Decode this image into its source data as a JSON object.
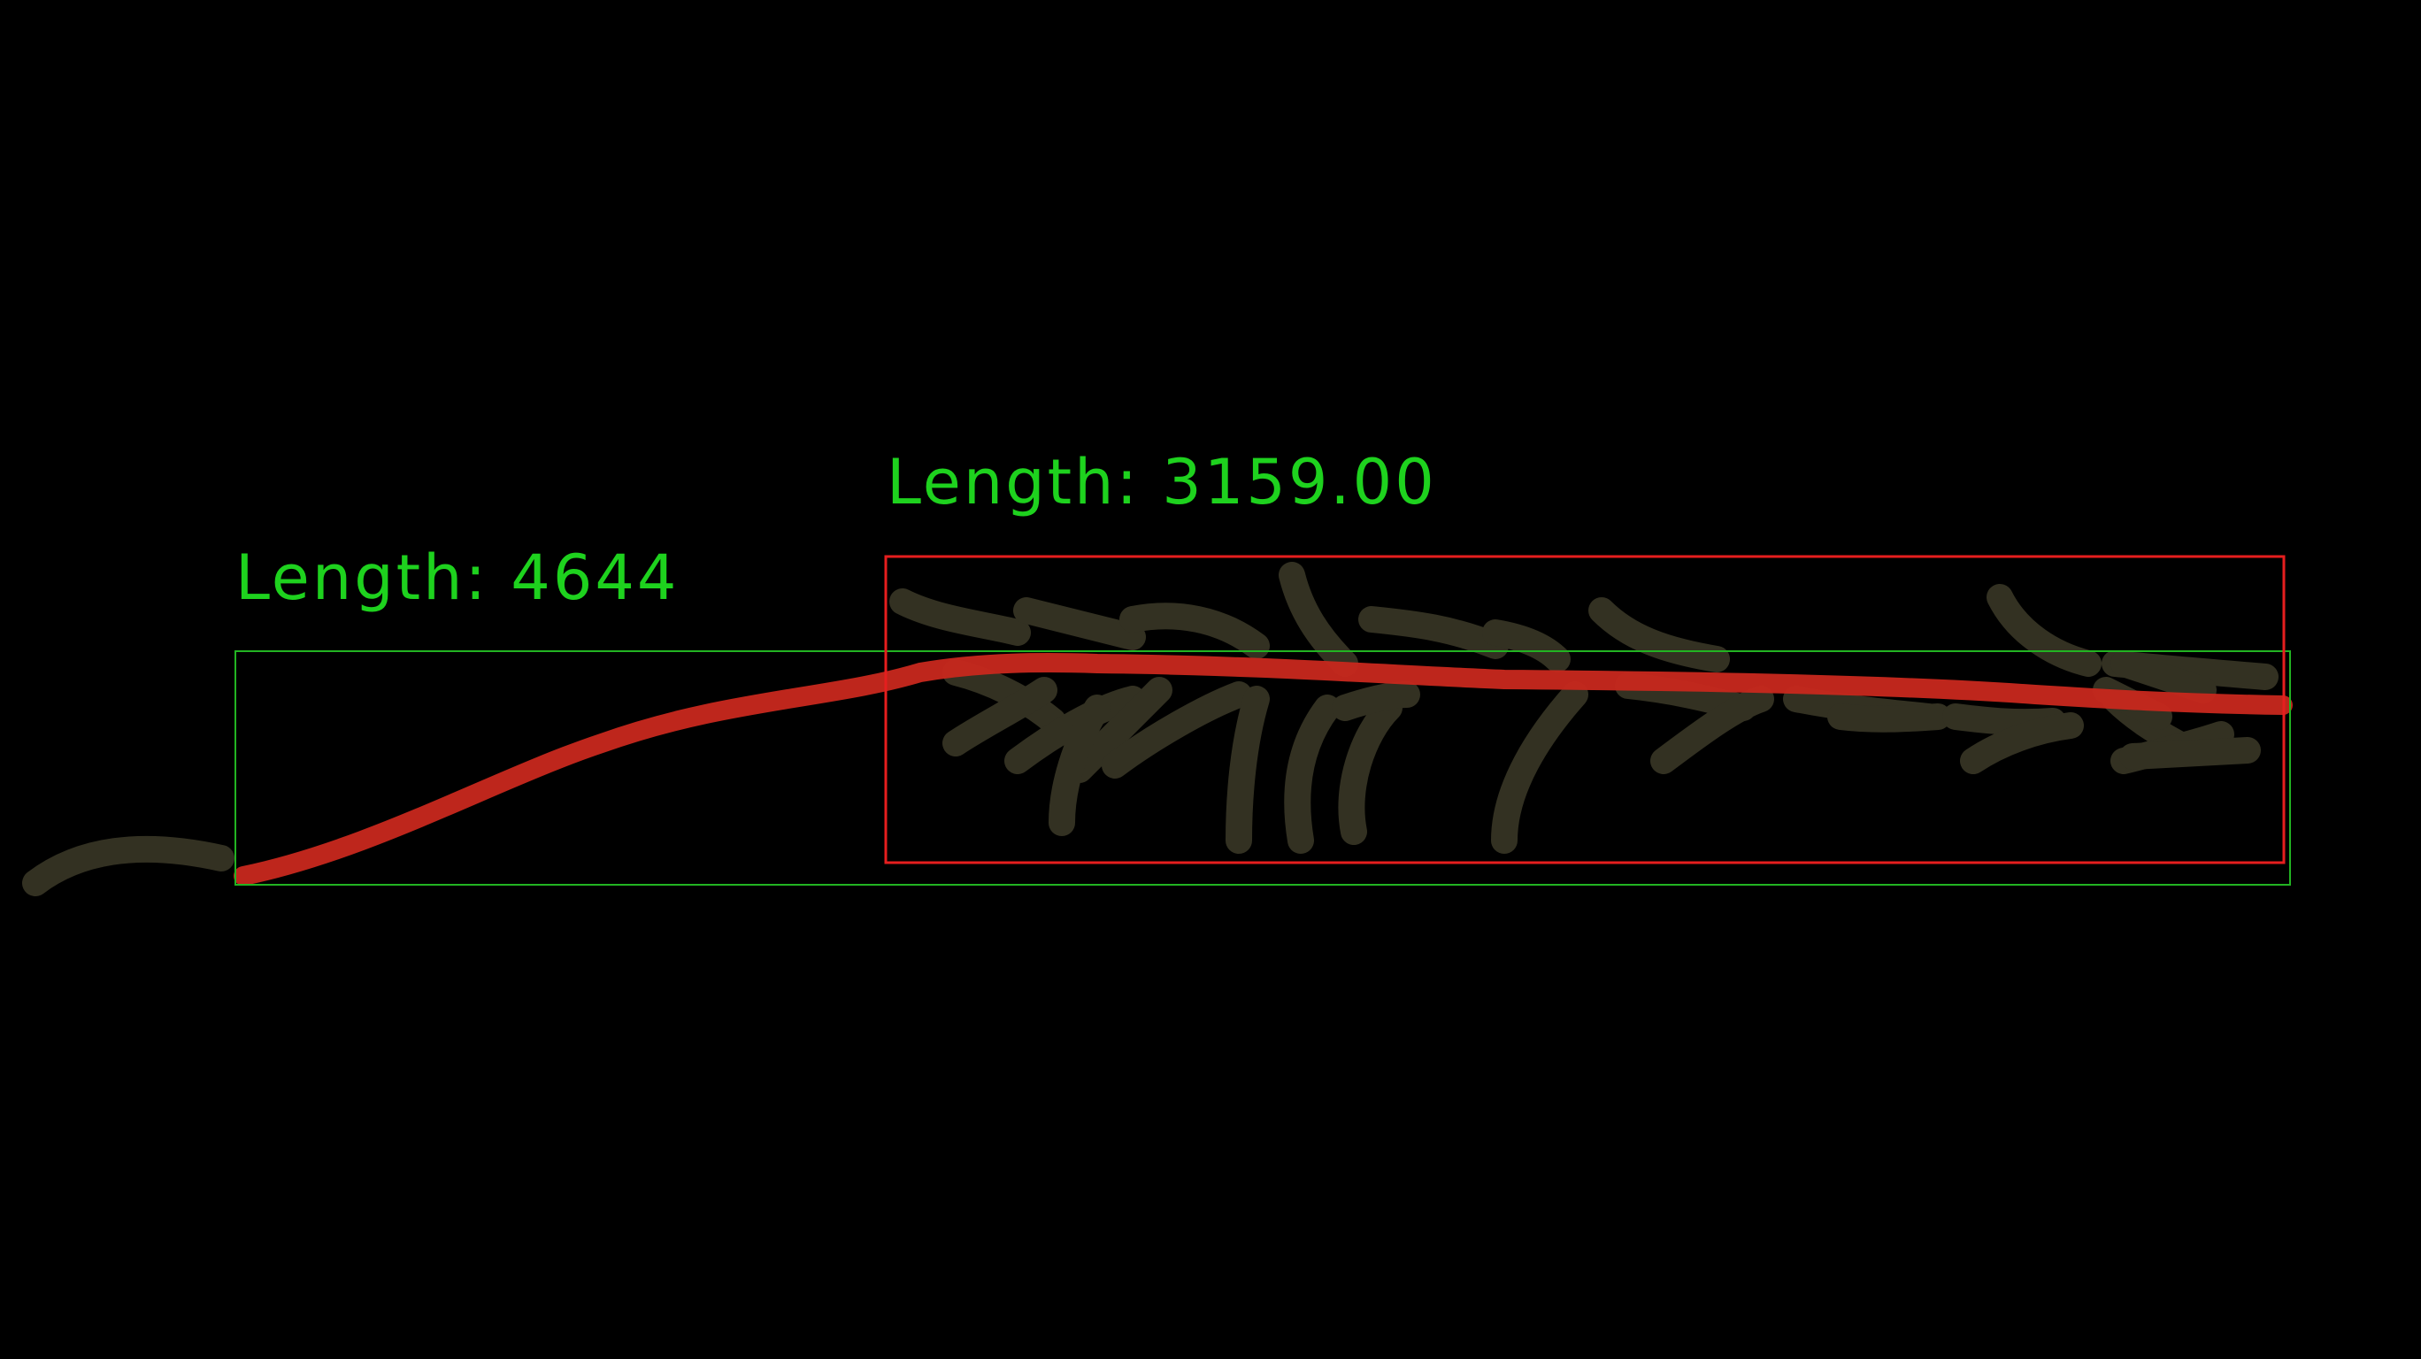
{
  "annotations": {
    "total_length_label": "Length: 4644",
    "main_axis_length_label": "Length: 3159.00"
  },
  "colors": {
    "background": "#000000",
    "label_text": "#1ed21e",
    "total_length_box": "#22b422",
    "main_axis_box": "#e61e1e",
    "traced_stem": "#c8281e",
    "plant_tissue": "#3c3a28"
  }
}
